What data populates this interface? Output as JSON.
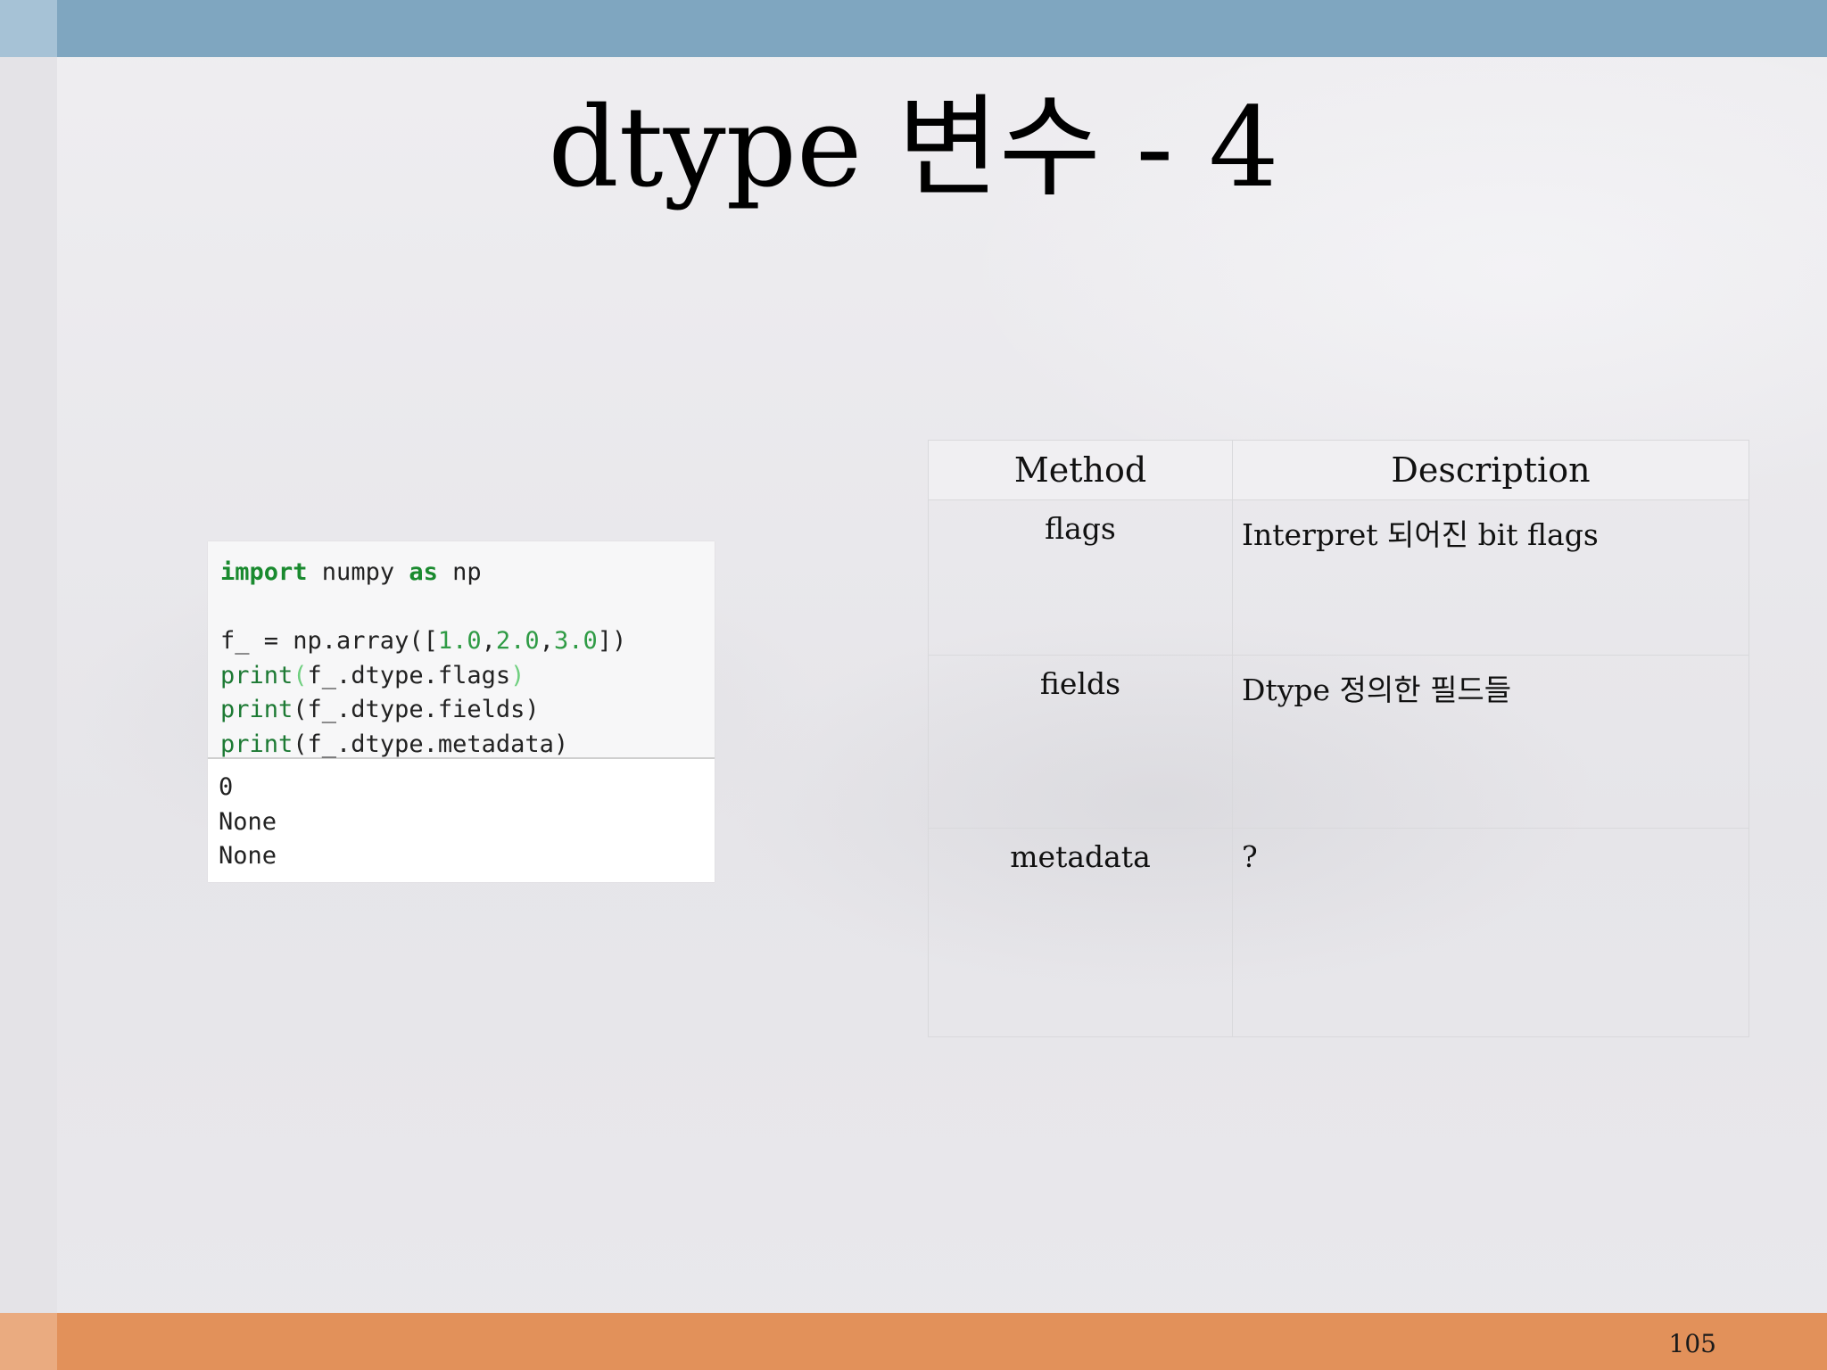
{
  "slide": {
    "title": "dtype 변수 - 4",
    "page_number": "105"
  },
  "code": {
    "input_lines": [
      [
        {
          "t": "import",
          "c": "kw"
        },
        {
          "t": " numpy ",
          "c": ""
        },
        {
          "t": "as",
          "c": "kw"
        },
        {
          "t": " np",
          "c": ""
        }
      ],
      [],
      [
        {
          "t": "f_ = np.array([",
          "c": ""
        },
        {
          "t": "1.0",
          "c": "num"
        },
        {
          "t": ",",
          "c": ""
        },
        {
          "t": "2.0",
          "c": "num"
        },
        {
          "t": ",",
          "c": ""
        },
        {
          "t": "3.0",
          "c": "num"
        },
        {
          "t": "])",
          "c": ""
        }
      ],
      [
        {
          "t": "print",
          "c": "fn"
        },
        {
          "t": "(",
          "c": "paren-hl"
        },
        {
          "t": "f_.dtype.flags",
          "c": ""
        },
        {
          "t": ")",
          "c": "paren-hl"
        }
      ],
      [
        {
          "t": "print",
          "c": "fn"
        },
        {
          "t": "(f_.dtype.fields)",
          "c": ""
        }
      ],
      [
        {
          "t": "print",
          "c": "fn"
        },
        {
          "t": "(f_.dtype.metadata)",
          "c": ""
        }
      ]
    ],
    "output_lines": [
      "0",
      "None",
      "None"
    ]
  },
  "table": {
    "headers": {
      "method": "Method",
      "description": "Description"
    },
    "rows": [
      {
        "method": "flags",
        "description": "Interpret 되어진 bit flags"
      },
      {
        "method": "fields",
        "description": "Dtype 정의한 필드들"
      },
      {
        "method": "metadata",
        "description": "?"
      }
    ]
  },
  "colors": {
    "top_bar": "#7fa6c0",
    "bottom_bar": "#e2915a",
    "keyword": "#1a8a2f",
    "number": "#2f9b45"
  }
}
